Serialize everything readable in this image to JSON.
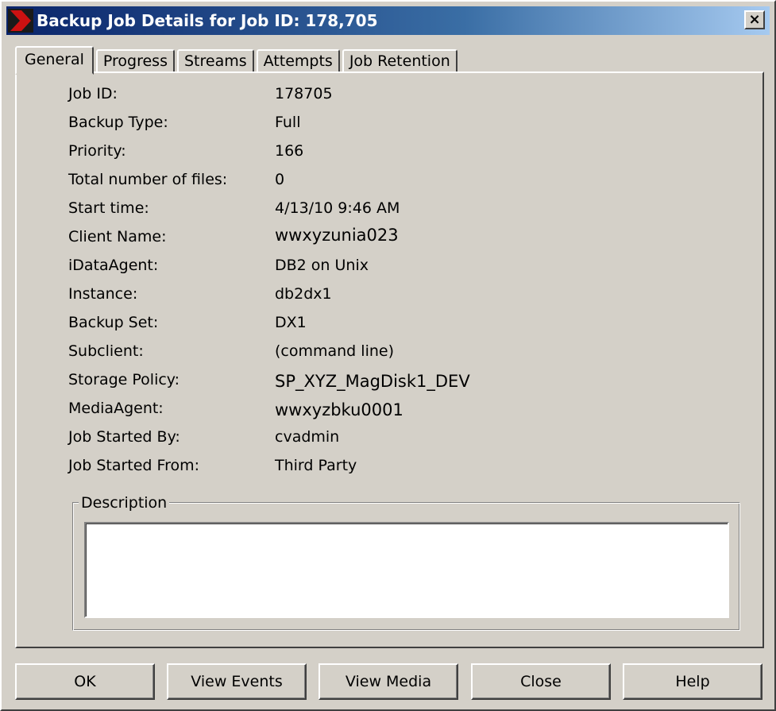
{
  "window": {
    "title": "Backup Job Details for Job ID: 178,705",
    "close_label": "×"
  },
  "tabs": [
    {
      "label": "General",
      "active": true
    },
    {
      "label": "Progress",
      "active": false
    },
    {
      "label": "Streams",
      "active": false
    },
    {
      "label": "Attempts",
      "active": false
    },
    {
      "label": "Job Retention",
      "active": false
    }
  ],
  "fields": [
    {
      "label": "Job ID:",
      "value": "178705"
    },
    {
      "label": "Backup Type:",
      "value": "Full"
    },
    {
      "label": "Priority:",
      "value": "166"
    },
    {
      "label": "Total number of files:",
      "value": "0"
    },
    {
      "label": "Start time:",
      "value": "4/13/10 9:46 AM"
    },
    {
      "label": "Client Name:",
      "value": "wwxyzunia023"
    },
    {
      "label": "iDataAgent:",
      "value": "DB2 on Unix"
    },
    {
      "label": "Instance:",
      "value": "db2dx1"
    },
    {
      "label": "Backup Set:",
      "value": "DX1"
    },
    {
      "label": "Subclient:",
      "value": "(command line)"
    },
    {
      "label": "Storage Policy:",
      "value": "SP_XYZ_MagDisk1_DEV"
    },
    {
      "label": "MediaAgent:",
      "value": "wwxyzbku0001"
    },
    {
      "label": "Job Started By:",
      "value": "cvadmin"
    },
    {
      "label": "Job Started From:",
      "value": "Third Party"
    }
  ],
  "description": {
    "title": "Description",
    "value": ""
  },
  "buttons": {
    "ok": "OK",
    "view_events": "View Events",
    "view_media": "View Media",
    "close": "Close",
    "help": "Help"
  },
  "colors": {
    "titlebar_start": "#0a246a",
    "titlebar_end": "#a6caf0",
    "face": "#d4d0c8",
    "icon_red": "#cc1111"
  }
}
